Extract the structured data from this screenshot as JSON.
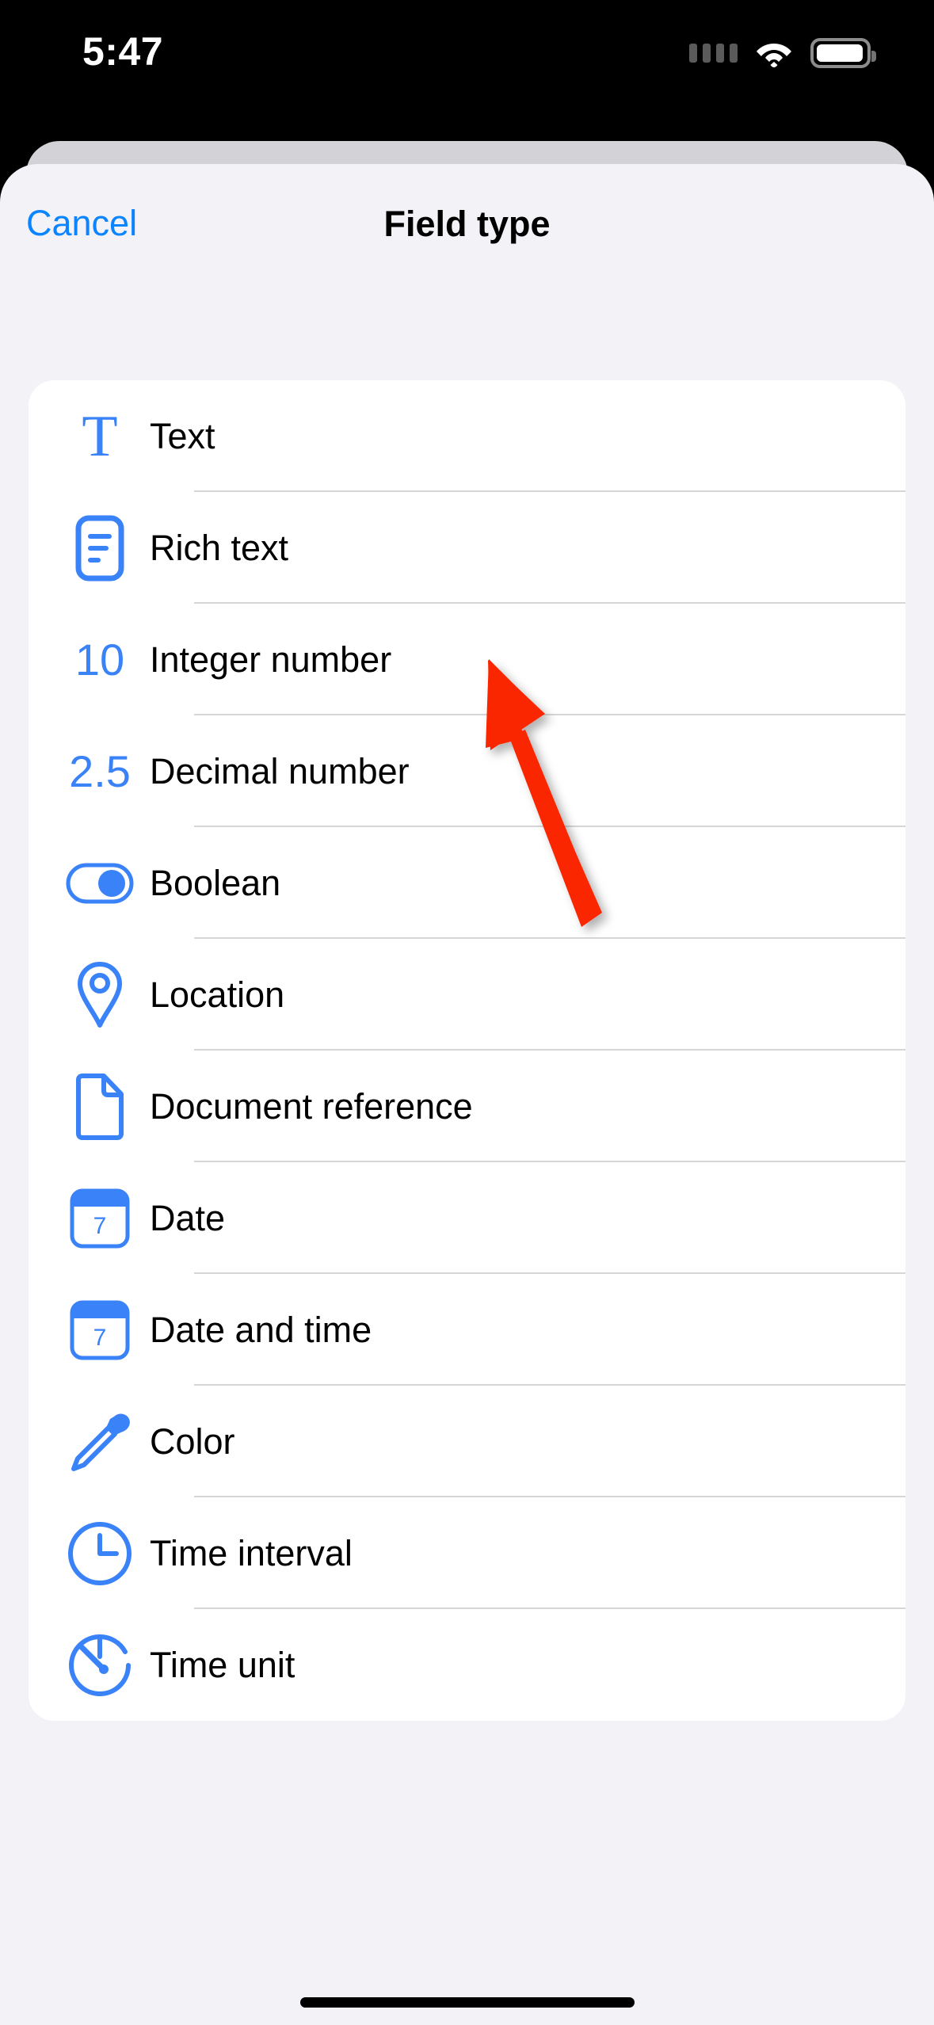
{
  "status_bar": {
    "time": "5:47",
    "cellular_icon": "cellular-signal-icon",
    "wifi_icon": "wifi-icon",
    "battery_icon": "battery-full-icon"
  },
  "sheet": {
    "nav": {
      "cancel_label": "Cancel",
      "title": "Field type"
    },
    "list": {
      "items": [
        {
          "label": "Text",
          "icon": "text-format-icon",
          "icon_text": "T"
        },
        {
          "label": "Rich text",
          "icon": "rich-text-document-icon",
          "icon_text": ""
        },
        {
          "label": "Integer number",
          "icon": "integer-number-icon",
          "icon_text": "10"
        },
        {
          "label": "Decimal number",
          "icon": "decimal-number-icon",
          "icon_text": "2.5"
        },
        {
          "label": "Boolean",
          "icon": "toggle-switch-icon",
          "icon_text": ""
        },
        {
          "label": "Location",
          "icon": "map-pin-icon",
          "icon_text": ""
        },
        {
          "label": "Document reference",
          "icon": "document-page-icon",
          "icon_text": ""
        },
        {
          "label": "Date",
          "icon": "calendar-icon",
          "icon_text": "7"
        },
        {
          "label": "Date and time",
          "icon": "calendar-clock-icon",
          "icon_text": "7"
        },
        {
          "label": "Color",
          "icon": "eyedropper-icon",
          "icon_text": ""
        },
        {
          "label": "Time interval",
          "icon": "clock-icon",
          "icon_text": ""
        },
        {
          "label": "Time unit",
          "icon": "stopwatch-icon",
          "icon_text": ""
        }
      ]
    }
  },
  "annotation": {
    "arrow_icon": "red-pointer-arrow",
    "arrow_color": "#FA2600",
    "points_at": "Integer number"
  },
  "colors": {
    "accent_blue": "#0a84ff",
    "icon_blue": "#3a82f7",
    "sheet_background": "#F2F2F7",
    "card_background": "#FFFFFF",
    "separator": "#D6D6D8",
    "status_bar_background": "#000000"
  },
  "home_indicator": {
    "name": "home-indicator"
  }
}
